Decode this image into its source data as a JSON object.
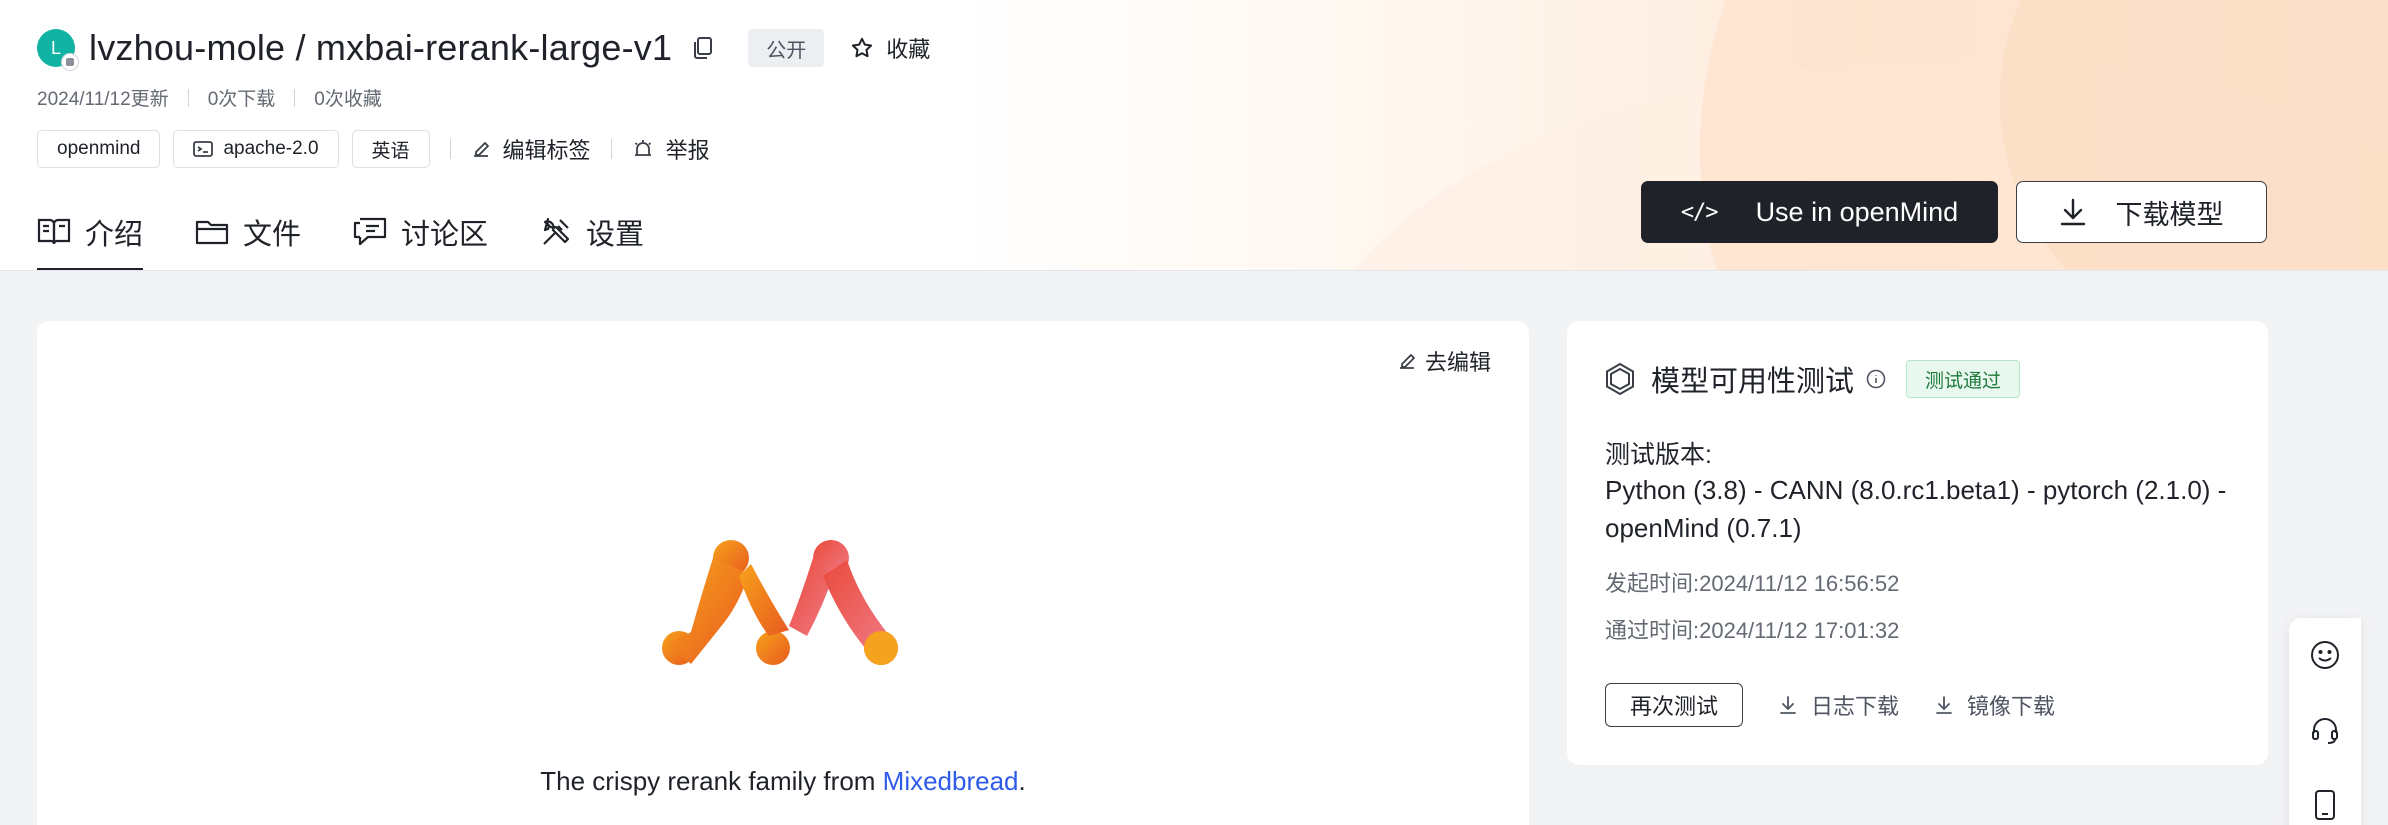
{
  "repo": {
    "avatar_letter": "L",
    "title": "lvzhou-mole / mxbai-rerank-large-v1",
    "visibility": "公开",
    "favorite_label": "收藏"
  },
  "meta": {
    "updated": "2024/11/12更新",
    "downloads": "0次下载",
    "favorites": "0次收藏"
  },
  "chips": [
    "openmind",
    "apache-2.0",
    "英语"
  ],
  "actions": {
    "edit_tags": "编辑标签",
    "report": "举报"
  },
  "tabs": [
    {
      "label": "介绍",
      "icon": "book-icon",
      "active": true
    },
    {
      "label": "文件",
      "icon": "folder-icon",
      "active": false
    },
    {
      "label": "讨论区",
      "icon": "chat-icon",
      "active": false
    },
    {
      "label": "设置",
      "icon": "tools-icon",
      "active": false
    }
  ],
  "buttons": {
    "use_openmind_code": "</>",
    "use_openmind": "Use in openMind",
    "download_model": "下载模型"
  },
  "readme": {
    "edit_label": "去编辑",
    "tagline_prefix": "The crispy rerank family from ",
    "tagline_link": "Mixedbread",
    "tagline_suffix": "."
  },
  "test_panel": {
    "title": "模型可用性测试",
    "status": "测试通过",
    "version_label": "测试版本:",
    "version_value": "Python (3.8) - CANN (8.0.rc1.beta1) - pytorch (2.1.0) - openMind (0.7.1)",
    "started": "发起时间:2024/11/12 16:56:52",
    "passed": "通过时间:2024/11/12 17:01:32",
    "retest_label": "再次测试",
    "log_download": "日志下载",
    "image_download": "镜像下载"
  },
  "colors": {
    "accent_dark": "#1f2329",
    "avatar": "#10b3a3",
    "link": "#2f5bea",
    "pass_badge": "#e8f8ee"
  }
}
